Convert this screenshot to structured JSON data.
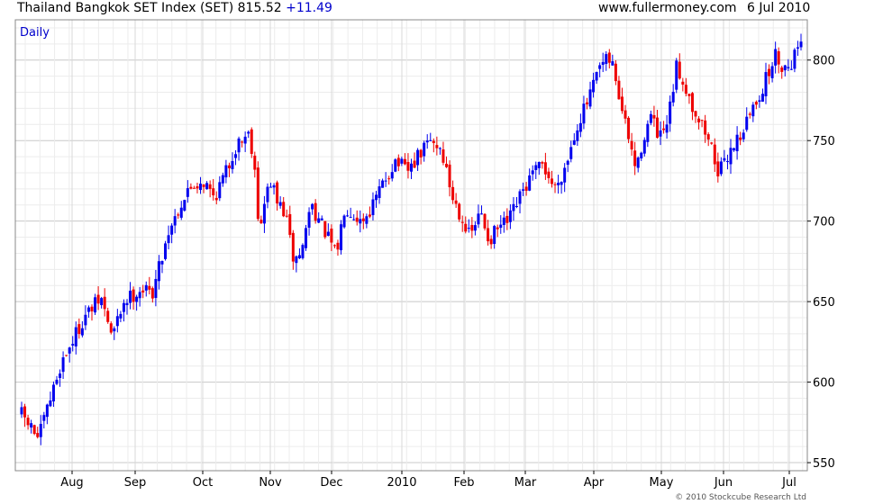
{
  "header": {
    "title": "Thailand Bangkok SET Index (SET)",
    "last": "815.52",
    "change": "+11.49",
    "site": "www.fullermoney.com",
    "date": "6 Jul 2010"
  },
  "chart_data": {
    "type": "candlestick",
    "period": "Daily",
    "ylim": [
      545,
      825
    ],
    "y_ticks": [
      550,
      600,
      650,
      700,
      750,
      800
    ],
    "x_month_labels": [
      "Aug",
      "Sep",
      "Oct",
      "Nov",
      "Dec",
      "2010",
      "Feb",
      "Mar",
      "Apr",
      "May",
      "Jun",
      "Jul"
    ],
    "grid": true,
    "up_color": "#0000ee",
    "down_color": "#ee0000",
    "bars": 245,
    "waypoints": [
      {
        "t": 0,
        "v": 580
      },
      {
        "t": 6,
        "v": 565
      },
      {
        "t": 14,
        "v": 612
      },
      {
        "t": 22,
        "v": 640
      },
      {
        "t": 28,
        "v": 652
      },
      {
        "t": 32,
        "v": 628
      },
      {
        "t": 36,
        "v": 650
      },
      {
        "t": 42,
        "v": 658
      },
      {
        "t": 46,
        "v": 655
      },
      {
        "t": 52,
        "v": 695
      },
      {
        "t": 56,
        "v": 710
      },
      {
        "t": 60,
        "v": 722
      },
      {
        "t": 64,
        "v": 725
      },
      {
        "t": 68,
        "v": 715
      },
      {
        "t": 72,
        "v": 730
      },
      {
        "t": 76,
        "v": 748
      },
      {
        "t": 80,
        "v": 755
      },
      {
        "t": 82,
        "v": 740
      },
      {
        "t": 84,
        "v": 690
      },
      {
        "t": 86,
        "v": 715
      },
      {
        "t": 88,
        "v": 725
      },
      {
        "t": 90,
        "v": 712
      },
      {
        "t": 93,
        "v": 705
      },
      {
        "t": 96,
        "v": 675
      },
      {
        "t": 99,
        "v": 682
      },
      {
        "t": 102,
        "v": 712
      },
      {
        "t": 105,
        "v": 700
      },
      {
        "t": 108,
        "v": 690
      },
      {
        "t": 111,
        "v": 678
      },
      {
        "t": 114,
        "v": 710
      },
      {
        "t": 117,
        "v": 705
      },
      {
        "t": 120,
        "v": 700
      },
      {
        "t": 124,
        "v": 710
      },
      {
        "t": 128,
        "v": 725
      },
      {
        "t": 132,
        "v": 738
      },
      {
        "t": 136,
        "v": 730
      },
      {
        "t": 140,
        "v": 740
      },
      {
        "t": 144,
        "v": 750
      },
      {
        "t": 148,
        "v": 745
      },
      {
        "t": 150,
        "v": 730
      },
      {
        "t": 152,
        "v": 715
      },
      {
        "t": 156,
        "v": 700
      },
      {
        "t": 158,
        "v": 690
      },
      {
        "t": 162,
        "v": 705
      },
      {
        "t": 165,
        "v": 688
      },
      {
        "t": 168,
        "v": 695
      },
      {
        "t": 172,
        "v": 700
      },
      {
        "t": 176,
        "v": 715
      },
      {
        "t": 180,
        "v": 728
      },
      {
        "t": 184,
        "v": 735
      },
      {
        "t": 188,
        "v": 720
      },
      {
        "t": 192,
        "v": 735
      },
      {
        "t": 196,
        "v": 760
      },
      {
        "t": 200,
        "v": 775
      },
      {
        "t": 204,
        "v": 795
      },
      {
        "t": 207,
        "v": 800
      },
      {
        "t": 209,
        "v": 795
      },
      {
        "t": 211,
        "v": 775
      },
      {
        "t": 213,
        "v": 760
      },
      {
        "t": 215,
        "v": 745
      },
      {
        "t": 217,
        "v": 730
      },
      {
        "t": 219,
        "v": 750
      },
      {
        "t": 222,
        "v": 765
      },
      {
        "t": 225,
        "v": 750
      },
      {
        "t": 228,
        "v": 760
      },
      {
        "t": 231,
        "v": 795
      },
      {
        "t": 234,
        "v": 785
      },
      {
        "t": 237,
        "v": 770
      },
      {
        "t": 240,
        "v": 760
      },
      {
        "t": 243,
        "v": 748
      },
      {
        "t": 246,
        "v": 730
      },
      {
        "t": 248,
        "v": 735
      },
      {
        "t": 250,
        "v": 745
      },
      {
        "t": 254,
        "v": 755
      },
      {
        "t": 258,
        "v": 770
      },
      {
        "t": 262,
        "v": 785
      },
      {
        "t": 266,
        "v": 803
      },
      {
        "t": 269,
        "v": 795
      },
      {
        "t": 272,
        "v": 800
      },
      {
        "t": 275,
        "v": 815
      }
    ]
  },
  "footer": {
    "copyright": "© 2010 Stockcube Research Ltd"
  }
}
